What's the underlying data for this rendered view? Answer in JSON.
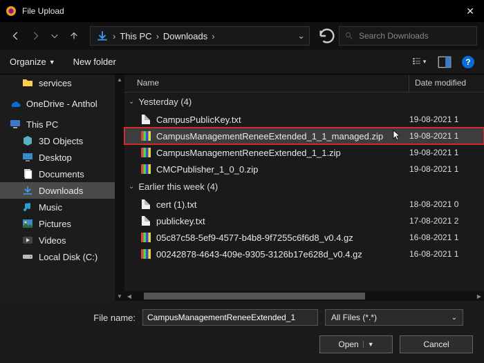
{
  "titlebar": {
    "title": "File Upload"
  },
  "nav": {
    "breadcrumb": {
      "root": "This PC",
      "folder": "Downloads"
    },
    "search_placeholder": "Search Downloads"
  },
  "toolbar": {
    "organize": "Organize",
    "newfolder": "New folder"
  },
  "sidebar": {
    "services": "services",
    "onedrive": "OneDrive - Anthol",
    "thispc": "This PC",
    "items": [
      {
        "label": "3D Objects"
      },
      {
        "label": "Desktop"
      },
      {
        "label": "Documents"
      },
      {
        "label": "Downloads"
      },
      {
        "label": "Music"
      },
      {
        "label": "Pictures"
      },
      {
        "label": "Videos"
      },
      {
        "label": "Local Disk (C:)"
      }
    ]
  },
  "list": {
    "header": {
      "name": "Name",
      "date": "Date modified"
    },
    "g1": {
      "title": "Yesterday (4)"
    },
    "g1rows": [
      {
        "name": "CampusPublicKey.txt",
        "date": "19-08-2021 1"
      },
      {
        "name": "CampusManagementReneeExtended_1_1_managed.zip",
        "date": "19-08-2021 1"
      },
      {
        "name": "CampusManagementReneeExtended_1_1.zip",
        "date": "19-08-2021 1"
      },
      {
        "name": "CMCPublisher_1_0_0.zip",
        "date": "19-08-2021 1"
      }
    ],
    "g2": {
      "title": "Earlier this week (4)"
    },
    "g2rows": [
      {
        "name": "cert (1).txt",
        "date": "18-08-2021 0"
      },
      {
        "name": "publickey.txt",
        "date": "17-08-2021 2"
      },
      {
        "name": "05c87c58-5ef9-4577-b4b8-9f7255c6f6d8_v0.4.gz",
        "date": "16-08-2021 1"
      },
      {
        "name": "00242878-4643-409e-9305-3126b17e628d_v0.4.gz",
        "date": "16-08-2021 1"
      }
    ]
  },
  "footer": {
    "filename_label": "File name:",
    "filename_value": "CampusManagementReneeExtended_1",
    "filter": "All Files (*.*)",
    "open": "Open",
    "cancel": "Cancel"
  }
}
